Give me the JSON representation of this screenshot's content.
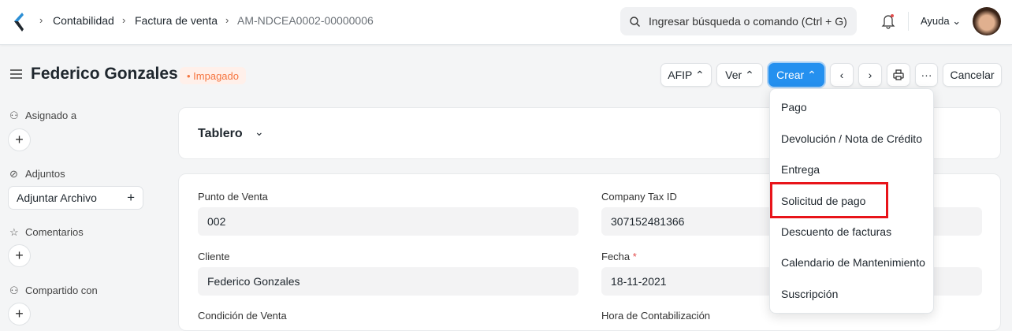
{
  "breadcrumb": [
    "Contabilidad",
    "Factura de venta",
    "AM-NDCEA0002-00000006"
  ],
  "search": {
    "placeholder": "Ingresar búsqueda o comando (Ctrl + G)"
  },
  "help_label": "Ayuda",
  "title": "Federico Gonzales",
  "status": "Impagado",
  "toolbar": {
    "afip": "AFIP",
    "ver": "Ver",
    "crear": "Crear",
    "cancel": "Cancelar",
    "more": "···"
  },
  "sidebar": {
    "assigned": "Asignado a",
    "attachments": "Adjuntos",
    "attach_button": "Adjuntar Archivo",
    "comments": "Comentarios",
    "shared": "Compartido con"
  },
  "dashboard": "Tablero",
  "fields": {
    "punto_label": "Punto de Venta",
    "punto_value": "002",
    "tax_label": "Company Tax ID",
    "tax_value": "307152481366",
    "cliente_label": "Cliente",
    "cliente_value": "Federico Gonzales",
    "fecha_label": "Fecha",
    "fecha_value": "18-11-2021",
    "required": "*",
    "condicion_label": "Condición de Venta",
    "hora_label": "Hora de Contabilización"
  },
  "menu": [
    "Pago",
    "Devolución / Nota de Crédito",
    "Entrega",
    "Solicitud de pago",
    "Descuento de facturas",
    "Calendario de Mantenimiento",
    "Suscripción"
  ],
  "colors": {
    "primary": "#2490ef",
    "status": "#f5753f",
    "highlight": "#e8141a"
  }
}
